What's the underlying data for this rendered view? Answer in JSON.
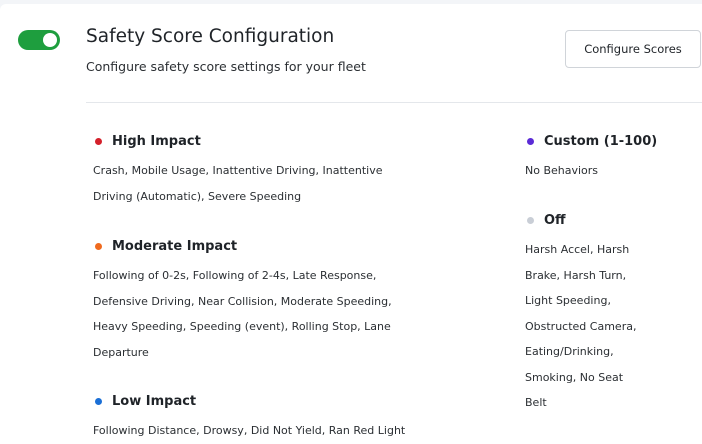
{
  "header": {
    "toggle_on": true,
    "title": "Safety Score Configuration",
    "subtitle": "Configure safety score settings for your fleet",
    "configure_button": "Configure Scores"
  },
  "colors": {
    "toggle_on": "#1e9e3e",
    "high_impact": "#d4202a",
    "moderate_impact": "#f06a1e",
    "low_impact": "#1a6fd6",
    "custom": "#5b2bd6",
    "off": "#c9ced6"
  },
  "groups": {
    "high": {
      "label": "High Impact",
      "lines": [
        "Crash, Mobile Usage, Inattentive Driving, Inattentive",
        "Driving (Automatic), Severe Speeding"
      ]
    },
    "moderate": {
      "label": "Moderate Impact",
      "lines": [
        "Following of 0-2s, Following of 2-4s, Late Response,",
        "Defensive Driving, Near Collision, Moderate Speeding,",
        "Heavy Speeding, Speeding (event), Rolling Stop, Lane",
        "Departure"
      ]
    },
    "low": {
      "label": "Low Impact",
      "lines": [
        "Following Distance, Drowsy, Did Not Yield, Ran Red Light"
      ]
    },
    "custom": {
      "label": "Custom (1-100)",
      "lines": [
        "No Behaviors"
      ]
    },
    "off": {
      "label": "Off",
      "lines": [
        "Harsh Accel, Harsh",
        "Brake, Harsh Turn,",
        "Light Speeding,",
        "Obstructed Camera,",
        "Eating/Drinking,",
        "Smoking, No Seat",
        "Belt"
      ]
    }
  }
}
